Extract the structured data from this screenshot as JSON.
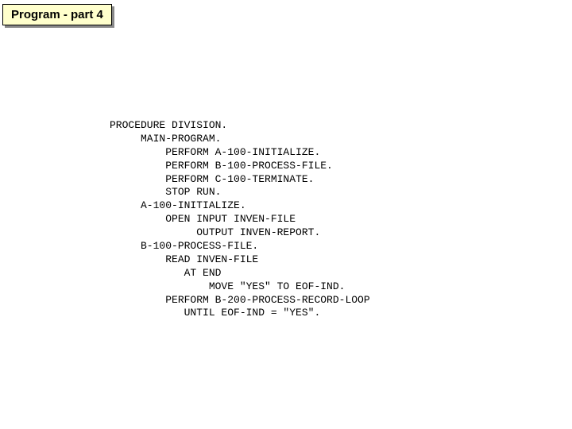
{
  "title": "Program - part 4",
  "code": "PROCEDURE DIVISION.\n     MAIN-PROGRAM.\n         PERFORM A-100-INITIALIZE.\n         PERFORM B-100-PROCESS-FILE.\n         PERFORM C-100-TERMINATE.\n         STOP RUN.\n     A-100-INITIALIZE.\n         OPEN INPUT INVEN-FILE\n              OUTPUT INVEN-REPORT.\n     B-100-PROCESS-FILE.\n         READ INVEN-FILE\n            AT END\n                MOVE \"YES\" TO EOF-IND.\n         PERFORM B-200-PROCESS-RECORD-LOOP\n            UNTIL EOF-IND = \"YES\"."
}
